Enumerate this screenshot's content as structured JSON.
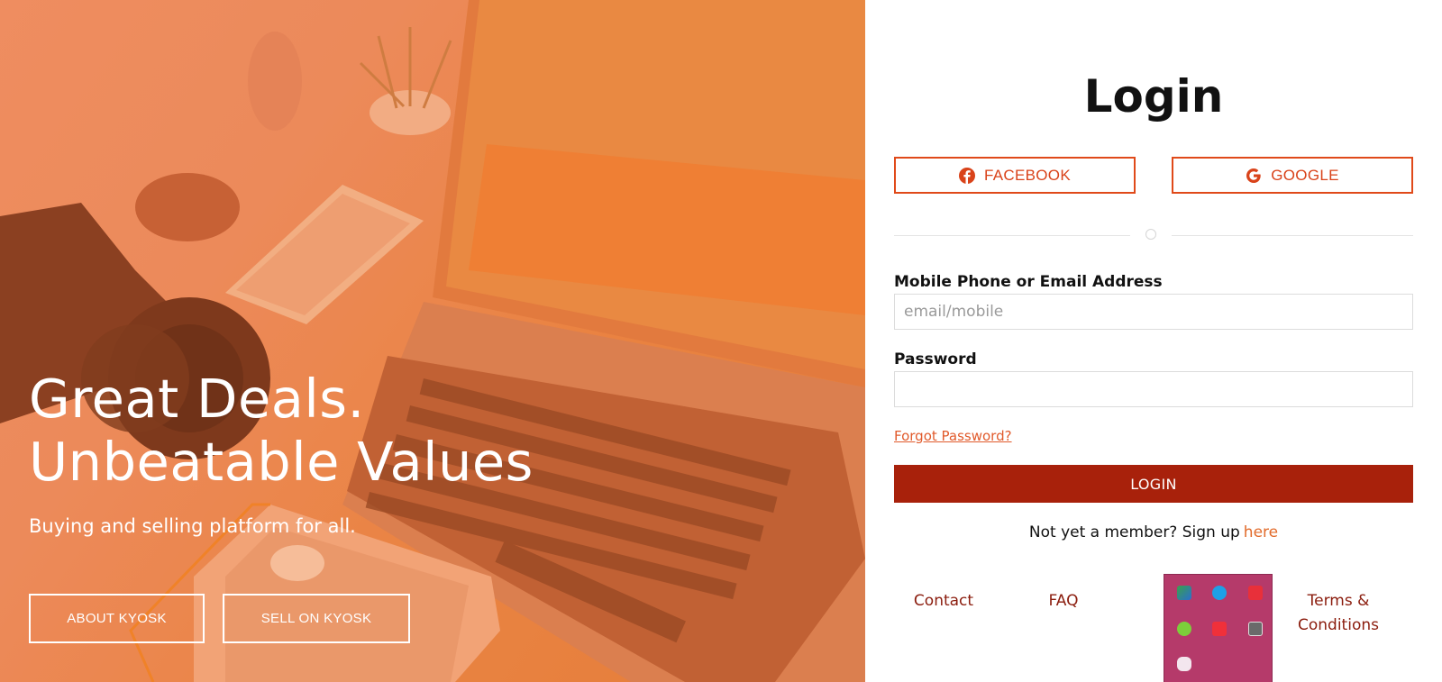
{
  "hero": {
    "headline_line1": "Great Deals.",
    "headline_line2": "Unbeatable Values",
    "tagline": "Buying and selling platform for all.",
    "buttons": {
      "about": "ABOUT KYOSK",
      "sell": "SELL ON KYOSK"
    }
  },
  "login": {
    "title": "Login",
    "facebook_label": "FACEBOOK",
    "google_label": "GOOGLE",
    "identifier_label": "Mobile Phone or Email Address",
    "identifier_placeholder": "email/mobile",
    "identifier_value": "",
    "password_label": "Password",
    "password_value": "",
    "forgot_label": "Forgot Password?",
    "submit_label": "LOGIN",
    "signup_text": "Not yet a member? Sign up",
    "signup_link": "here"
  },
  "footer": {
    "contact": "Contact",
    "faq": "FAQ",
    "terms_line1": "Terms &",
    "terms_line2": "Conditions"
  },
  "tray": {
    "icons": [
      "network-icon",
      "skype-icon",
      "s-app-icon",
      "utorrent-icon",
      "screen-share-icon",
      "monitor-icon",
      "discord-icon"
    ]
  },
  "colors": {
    "accent": "#e04a1a",
    "login_button": "#a8210b",
    "link": "#e26b2b",
    "footer_link": "#8b1d0e",
    "hero_overlay": "#eb8a5b",
    "tray_background": "#b53a6a"
  }
}
